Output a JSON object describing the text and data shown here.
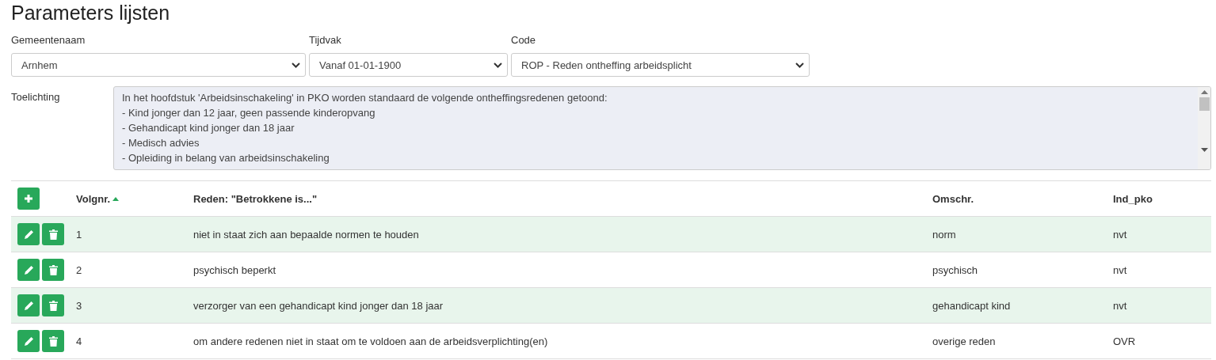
{
  "page": {
    "title": "Parameters lijsten"
  },
  "filters": [
    {
      "label": "Gemeentenaam",
      "value": "Arnhem"
    },
    {
      "label": "Tijdvak",
      "value": "Vanaf 01-01-1900"
    },
    {
      "label": "Code",
      "value": "ROP - Reden ontheffing arbeidsplicht"
    }
  ],
  "toelichting": {
    "label": "Toelichting",
    "lines": [
      "In het hoofdstuk 'Arbeidsinschakeling' in PKO worden standaard de volgende ontheffingsredenen getoond:",
      "- Kind jonger dan 12 jaar, geen passende kinderopvang",
      "- Gehandicapt kind jonger dan 18 jaar",
      "- Medisch advies",
      "- Opleiding in belang van arbeidsinschakeling"
    ]
  },
  "table": {
    "columns": [
      {
        "label": "Volgnr.",
        "sorted": true
      },
      {
        "label": "Reden: \"Betrokkene is...\"",
        "sorted": false
      },
      {
        "label": "Omschr.",
        "sorted": false
      },
      {
        "label": "Ind_pko",
        "sorted": false
      }
    ],
    "rows": [
      {
        "cells": [
          "1",
          "niet in staat zich aan bepaalde normen te houden",
          "norm",
          "nvt"
        ]
      },
      {
        "cells": [
          "2",
          "psychisch beperkt",
          "psychisch",
          "nvt"
        ]
      },
      {
        "cells": [
          "3",
          "verzorger van een gehandicapt kind jonger dan 18 jaar",
          "gehandicapt kind",
          "nvt"
        ]
      },
      {
        "cells": [
          "4",
          "om andere redenen niet in staat om te voldoen aan de arbeidsverplichting(en)",
          "overige reden",
          "OVR"
        ]
      }
    ]
  }
}
